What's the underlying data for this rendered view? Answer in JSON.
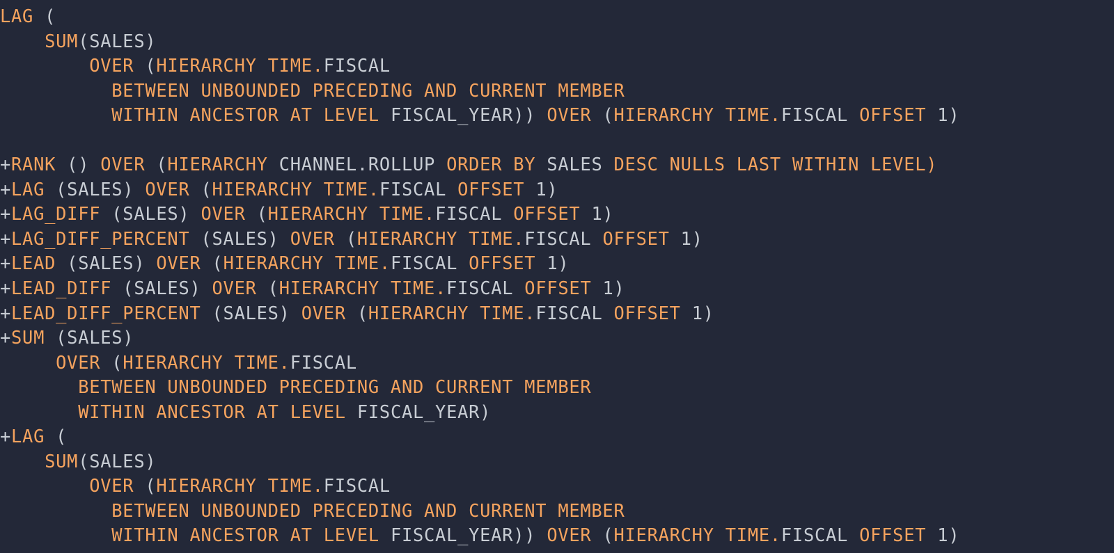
{
  "editor": {
    "kind": "sql-code-snippet",
    "background_color": "#232838",
    "keyword_color": "#f5a35e",
    "identifier_color": "#c8cdd4",
    "font_size_px": 25,
    "line_height_px": 35.5
  },
  "code": {
    "language": "SQL",
    "lines": [
      {
        "index": 0,
        "text": "LAG (",
        "tokens": [
          {
            "t": "LAG",
            "c": "kw"
          },
          {
            "t": " (",
            "c": "pn"
          }
        ]
      },
      {
        "index": 1,
        "text": "    SUM(SALES)",
        "tokens": [
          {
            "t": "    ",
            "c": "pn"
          },
          {
            "t": "SUM",
            "c": "kw"
          },
          {
            "t": "(SALES)",
            "c": "id"
          }
        ]
      },
      {
        "index": 2,
        "text": "        OVER (HIERARCHY TIME.FISCAL",
        "tokens": [
          {
            "t": "        ",
            "c": "pn"
          },
          {
            "t": "OVER",
            "c": "kw"
          },
          {
            "t": " (",
            "c": "pn"
          },
          {
            "t": "HIERARCHY TIME.",
            "c": "kw"
          },
          {
            "t": "FISCAL",
            "c": "id"
          }
        ]
      },
      {
        "index": 3,
        "text": "          BETWEEN UNBOUNDED PRECEDING AND CURRENT MEMBER",
        "tokens": [
          {
            "t": "          ",
            "c": "pn"
          },
          {
            "t": "BETWEEN UNBOUNDED PRECEDING AND CURRENT MEMBER",
            "c": "kw"
          }
        ]
      },
      {
        "index": 4,
        "text": "          WITHIN ANCESTOR AT LEVEL FISCAL_YEAR)) OVER (HIERARCHY TIME.FISCAL OFFSET 1)",
        "tokens": [
          {
            "t": "          ",
            "c": "pn"
          },
          {
            "t": "WITHIN ANCESTOR AT LEVEL ",
            "c": "kw"
          },
          {
            "t": "FISCAL_YEAR))",
            "c": "id"
          },
          {
            "t": " OVER",
            "c": "kw"
          },
          {
            "t": " (",
            "c": "pn"
          },
          {
            "t": "HIERARCHY TIME.",
            "c": "kw"
          },
          {
            "t": "FISCAL",
            "c": "id"
          },
          {
            "t": " OFFSET",
            "c": "kw"
          },
          {
            "t": " 1)",
            "c": "num"
          }
        ]
      },
      {
        "index": 5,
        "text": "",
        "tokens": []
      },
      {
        "index": 6,
        "text": "+RANK () OVER (HIERARCHY CHANNEL.ROLLUP ORDER BY SALES DESC NULLS LAST WITHIN LEVEL)",
        "tokens": [
          {
            "t": "+",
            "c": "pls"
          },
          {
            "t": "RANK",
            "c": "kw"
          },
          {
            "t": " () ",
            "c": "pn"
          },
          {
            "t": "OVER",
            "c": "kw"
          },
          {
            "t": " (",
            "c": "pn"
          },
          {
            "t": "HIERARCHY ",
            "c": "kw"
          },
          {
            "t": "CHANNEL.ROLLUP ",
            "c": "id"
          },
          {
            "t": "ORDER BY ",
            "c": "kw"
          },
          {
            "t": "SALES ",
            "c": "id"
          },
          {
            "t": "DESC NULLS LAST WITHIN LEVEL)",
            "c": "kw"
          }
        ]
      },
      {
        "index": 7,
        "text": "+LAG (SALES) OVER (HIERARCHY TIME.FISCAL OFFSET 1)",
        "tokens": [
          {
            "t": "+",
            "c": "pls"
          },
          {
            "t": "LAG",
            "c": "kw"
          },
          {
            "t": " (SALES) ",
            "c": "id"
          },
          {
            "t": "OVER",
            "c": "kw"
          },
          {
            "t": " (",
            "c": "pn"
          },
          {
            "t": "HIERARCHY TIME.",
            "c": "kw"
          },
          {
            "t": "FISCAL",
            "c": "id"
          },
          {
            "t": " OFFSET",
            "c": "kw"
          },
          {
            "t": " 1)",
            "c": "num"
          }
        ]
      },
      {
        "index": 8,
        "text": "+LAG_DIFF (SALES) OVER (HIERARCHY TIME.FISCAL OFFSET 1)",
        "tokens": [
          {
            "t": "+",
            "c": "pls"
          },
          {
            "t": "LAG_DIFF",
            "c": "kw"
          },
          {
            "t": " (SALES) ",
            "c": "id"
          },
          {
            "t": "OVER",
            "c": "kw"
          },
          {
            "t": " (",
            "c": "pn"
          },
          {
            "t": "HIERARCHY TIME.",
            "c": "kw"
          },
          {
            "t": "FISCAL",
            "c": "id"
          },
          {
            "t": " OFFSET",
            "c": "kw"
          },
          {
            "t": " 1)",
            "c": "num"
          }
        ]
      },
      {
        "index": 9,
        "text": "+LAG_DIFF_PERCENT (SALES) OVER (HIERARCHY TIME.FISCAL OFFSET 1)",
        "tokens": [
          {
            "t": "+",
            "c": "pls"
          },
          {
            "t": "LAG_DIFF_PERCENT",
            "c": "kw"
          },
          {
            "t": " (SALES) ",
            "c": "id"
          },
          {
            "t": "OVER",
            "c": "kw"
          },
          {
            "t": " (",
            "c": "pn"
          },
          {
            "t": "HIERARCHY TIME.",
            "c": "kw"
          },
          {
            "t": "FISCAL",
            "c": "id"
          },
          {
            "t": " OFFSET",
            "c": "kw"
          },
          {
            "t": " 1)",
            "c": "num"
          }
        ]
      },
      {
        "index": 10,
        "text": "+LEAD (SALES) OVER (HIERARCHY TIME.FISCAL OFFSET 1)",
        "tokens": [
          {
            "t": "+",
            "c": "pls"
          },
          {
            "t": "LEAD",
            "c": "kw"
          },
          {
            "t": " (SALES) ",
            "c": "id"
          },
          {
            "t": "OVER",
            "c": "kw"
          },
          {
            "t": " (",
            "c": "pn"
          },
          {
            "t": "HIERARCHY TIME.",
            "c": "kw"
          },
          {
            "t": "FISCAL",
            "c": "id"
          },
          {
            "t": " OFFSET",
            "c": "kw"
          },
          {
            "t": " 1)",
            "c": "num"
          }
        ]
      },
      {
        "index": 11,
        "text": "+LEAD_DIFF (SALES) OVER (HIERARCHY TIME.FISCAL OFFSET 1)",
        "tokens": [
          {
            "t": "+",
            "c": "pls"
          },
          {
            "t": "LEAD_DIFF",
            "c": "kw"
          },
          {
            "t": " (SALES) ",
            "c": "id"
          },
          {
            "t": "OVER",
            "c": "kw"
          },
          {
            "t": " (",
            "c": "pn"
          },
          {
            "t": "HIERARCHY TIME.",
            "c": "kw"
          },
          {
            "t": "FISCAL",
            "c": "id"
          },
          {
            "t": " OFFSET",
            "c": "kw"
          },
          {
            "t": " 1)",
            "c": "num"
          }
        ]
      },
      {
        "index": 12,
        "text": "+LEAD_DIFF_PERCENT (SALES) OVER (HIERARCHY TIME.FISCAL OFFSET 1)",
        "tokens": [
          {
            "t": "+",
            "c": "pls"
          },
          {
            "t": "LEAD_DIFF_PERCENT",
            "c": "kw"
          },
          {
            "t": " (SALES) ",
            "c": "id"
          },
          {
            "t": "OVER",
            "c": "kw"
          },
          {
            "t": " (",
            "c": "pn"
          },
          {
            "t": "HIERARCHY TIME.",
            "c": "kw"
          },
          {
            "t": "FISCAL",
            "c": "id"
          },
          {
            "t": " OFFSET",
            "c": "kw"
          },
          {
            "t": " 1)",
            "c": "num"
          }
        ]
      },
      {
        "index": 13,
        "text": "+SUM (SALES)",
        "tokens": [
          {
            "t": "+",
            "c": "pls"
          },
          {
            "t": "SUM",
            "c": "kw"
          },
          {
            "t": " (SALES)",
            "c": "id"
          }
        ]
      },
      {
        "index": 14,
        "text": "     OVER (HIERARCHY TIME.FISCAL",
        "tokens": [
          {
            "t": "     ",
            "c": "pn"
          },
          {
            "t": "OVER",
            "c": "kw"
          },
          {
            "t": " (",
            "c": "pn"
          },
          {
            "t": "HIERARCHY TIME.",
            "c": "kw"
          },
          {
            "t": "FISCAL",
            "c": "id"
          }
        ]
      },
      {
        "index": 15,
        "text": "       BETWEEN UNBOUNDED PRECEDING AND CURRENT MEMBER",
        "tokens": [
          {
            "t": "       ",
            "c": "pn"
          },
          {
            "t": "BETWEEN UNBOUNDED PRECEDING AND CURRENT MEMBER",
            "c": "kw"
          }
        ]
      },
      {
        "index": 16,
        "text": "       WITHIN ANCESTOR AT LEVEL FISCAL_YEAR)",
        "tokens": [
          {
            "t": "       ",
            "c": "pn"
          },
          {
            "t": "WITHIN ANCESTOR AT LEVEL ",
            "c": "kw"
          },
          {
            "t": "FISCAL_YEAR)",
            "c": "id"
          }
        ]
      },
      {
        "index": 17,
        "text": "+LAG (",
        "tokens": [
          {
            "t": "+",
            "c": "pls"
          },
          {
            "t": "LAG",
            "c": "kw"
          },
          {
            "t": " (",
            "c": "pn"
          }
        ]
      },
      {
        "index": 18,
        "text": "    SUM(SALES)",
        "tokens": [
          {
            "t": "    ",
            "c": "pn"
          },
          {
            "t": "SUM",
            "c": "kw"
          },
          {
            "t": "(SALES)",
            "c": "id"
          }
        ]
      },
      {
        "index": 19,
        "text": "        OVER (HIERARCHY TIME.FISCAL",
        "tokens": [
          {
            "t": "        ",
            "c": "pn"
          },
          {
            "t": "OVER",
            "c": "kw"
          },
          {
            "t": " (",
            "c": "pn"
          },
          {
            "t": "HIERARCHY TIME.",
            "c": "kw"
          },
          {
            "t": "FISCAL",
            "c": "id"
          }
        ]
      },
      {
        "index": 20,
        "text": "          BETWEEN UNBOUNDED PRECEDING AND CURRENT MEMBER",
        "tokens": [
          {
            "t": "          ",
            "c": "pn"
          },
          {
            "t": "BETWEEN UNBOUNDED PRECEDING AND CURRENT MEMBER",
            "c": "kw"
          }
        ]
      },
      {
        "index": 21,
        "text": "          WITHIN ANCESTOR AT LEVEL FISCAL_YEAR)) OVER (HIERARCHY TIME.FISCAL OFFSET 1)",
        "tokens": [
          {
            "t": "          ",
            "c": "pn"
          },
          {
            "t": "WITHIN ANCESTOR AT LEVEL ",
            "c": "kw"
          },
          {
            "t": "FISCAL_YEAR))",
            "c": "id"
          },
          {
            "t": " OVER",
            "c": "kw"
          },
          {
            "t": " (",
            "c": "pn"
          },
          {
            "t": "HIERARCHY TIME.",
            "c": "kw"
          },
          {
            "t": "FISCAL",
            "c": "id"
          },
          {
            "t": " OFFSET",
            "c": "kw"
          },
          {
            "t": " 1)",
            "c": "num"
          }
        ]
      }
    ]
  }
}
